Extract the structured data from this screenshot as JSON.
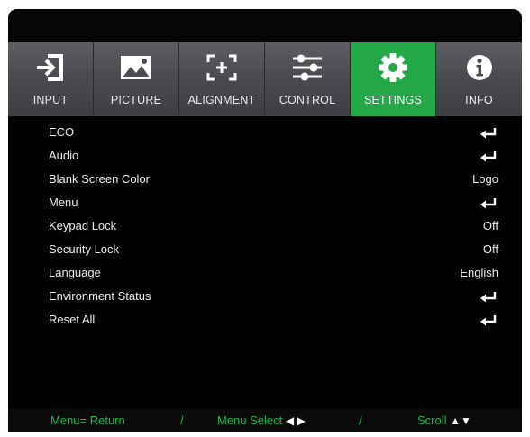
{
  "tabs": [
    {
      "label": "INPUT",
      "icon": "input-icon",
      "active": false
    },
    {
      "label": "PICTURE",
      "icon": "picture-icon",
      "active": false
    },
    {
      "label": "ALIGNMENT",
      "icon": "alignment-icon",
      "active": false
    },
    {
      "label": "CONTROL",
      "icon": "control-icon",
      "active": false
    },
    {
      "label": "SETTINGS",
      "icon": "gear-icon",
      "active": true
    },
    {
      "label": "INFO",
      "icon": "info-icon",
      "active": false
    }
  ],
  "menu": [
    {
      "label": "ECO",
      "value": "",
      "enter": true
    },
    {
      "label": "Audio",
      "value": "",
      "enter": true
    },
    {
      "label": "Blank Screen Color",
      "value": "Logo",
      "enter": false
    },
    {
      "label": "Menu",
      "value": "",
      "enter": true
    },
    {
      "label": "Keypad Lock",
      "value": "Off",
      "enter": false
    },
    {
      "label": "Security Lock",
      "value": "Off",
      "enter": false
    },
    {
      "label": "Language",
      "value": "English",
      "enter": false
    },
    {
      "label": "Environment Status",
      "value": "",
      "enter": true
    },
    {
      "label": "Reset All",
      "value": "",
      "enter": true
    }
  ],
  "footer": {
    "return_hint": "Menu= Return",
    "sep1": "/",
    "select_hint": "Menu Select",
    "select_arrows": "◀ ▶",
    "sep2": "/",
    "scroll_hint": "Scroll",
    "scroll_arrows": "▲▼"
  },
  "colors": {
    "accent": "#23a848",
    "footer_text": "#1fb74a",
    "tab_bg": "#4a4c50"
  }
}
